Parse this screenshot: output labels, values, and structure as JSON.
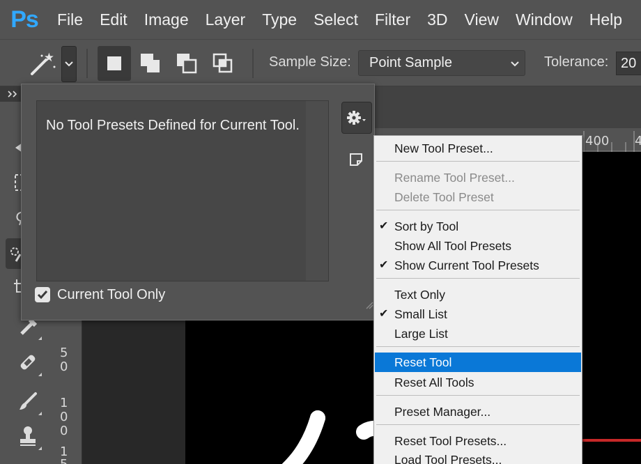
{
  "app": {
    "logo": "Ps"
  },
  "menubar": {
    "items": [
      "File",
      "Edit",
      "Image",
      "Layer",
      "Type",
      "Select",
      "Filter",
      "3D",
      "View",
      "Window",
      "Help"
    ]
  },
  "options": {
    "sample_size_label": "Sample Size:",
    "sample_size_value": "Point Sample",
    "tolerance_label": "Tolerance:",
    "tolerance_value": "20"
  },
  "preset_panel": {
    "empty_message": "No Tool Presets Defined for Current Tool.",
    "current_tool_only_label": "Current Tool Only",
    "current_tool_only_checked": true
  },
  "context_menu": {
    "items": [
      {
        "label": "New Tool Preset...",
        "enabled": true,
        "checked": false
      },
      {
        "label": "Rename Tool Preset...",
        "enabled": false,
        "checked": false
      },
      {
        "label": "Delete Tool Preset",
        "enabled": false,
        "checked": false
      },
      {
        "label": "Sort by Tool",
        "enabled": true,
        "checked": true
      },
      {
        "label": "Show All Tool Presets",
        "enabled": true,
        "checked": false
      },
      {
        "label": "Show Current Tool Presets",
        "enabled": true,
        "checked": true
      },
      {
        "label": "Text Only",
        "enabled": true,
        "checked": false
      },
      {
        "label": "Small List",
        "enabled": true,
        "checked": true
      },
      {
        "label": "Large List",
        "enabled": true,
        "checked": false
      },
      {
        "label": "Reset Tool",
        "enabled": true,
        "checked": false,
        "highlighted": true
      },
      {
        "label": "Reset All Tools",
        "enabled": true,
        "checked": false
      },
      {
        "label": "Preset Manager...",
        "enabled": true,
        "checked": false
      },
      {
        "label": "Reset Tool Presets...",
        "enabled": true,
        "checked": false
      },
      {
        "label": "Load Tool Presets...",
        "enabled": true,
        "checked": false
      }
    ]
  },
  "rulers": {
    "top_marks": [
      "400",
      "4"
    ],
    "left_marks": [
      "5",
      "0",
      "1",
      "0",
      "0",
      "1",
      "5"
    ]
  },
  "colors": {
    "accent": "#0a78d7",
    "ps_logo": "#31a8ff"
  }
}
